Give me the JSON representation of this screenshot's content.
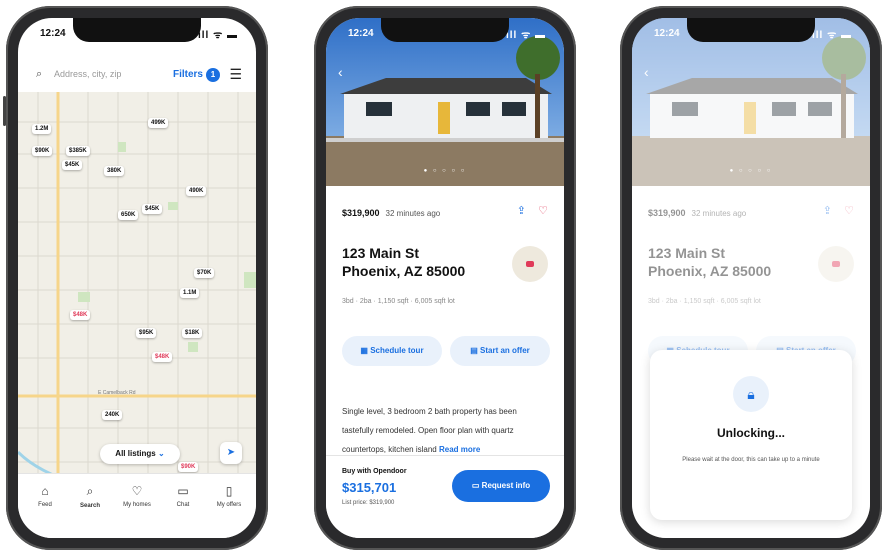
{
  "status": {
    "time": "12:24",
    "signal": "ıll ᯤ ▬"
  },
  "search": {
    "placeholder": "Address, city, zip",
    "filters_label": "Filters",
    "filters_count": "1"
  },
  "map": {
    "pins": [
      {
        "label": "1.2M"
      },
      {
        "label": "499K"
      },
      {
        "label": "$90K"
      },
      {
        "label": "$385K"
      },
      {
        "label": "$45K"
      },
      {
        "label": "380K"
      },
      {
        "label": "490K"
      },
      {
        "label": "$45K"
      },
      {
        "label": "650K"
      },
      {
        "label": "$70K"
      },
      {
        "label": "1.1M"
      },
      {
        "label": "$48K"
      },
      {
        "label": "$95K"
      },
      {
        "label": "$18K"
      },
      {
        "label": "$48K"
      },
      {
        "label": "240K"
      },
      {
        "label": "$90K"
      }
    ],
    "all_listings": "All listings",
    "street_label": "E Camelback Rd"
  },
  "tabs": [
    {
      "icon": "home-icon",
      "label": "Feed"
    },
    {
      "icon": "search-icon",
      "label": "Search"
    },
    {
      "icon": "heart-icon",
      "label": "My homes"
    },
    {
      "icon": "chat-icon",
      "label": "Chat"
    },
    {
      "icon": "document-icon",
      "label": "My offers"
    }
  ],
  "listing": {
    "price": "$319,900",
    "time_ago": "32 minutes ago",
    "address_line1": "123 Main St",
    "address_line2": "Phoenix, AZ 85000",
    "facts": "3bd · 2ba · 1,150 sqft · 6,005 sqft lot",
    "schedule_tour": "Schedule tour",
    "start_offer": "Start an offer",
    "description": "Single level, 3 bedroom 2 bath property has been tastefully remodeled. Open floor plan with quartz countertops, kitchen island",
    "read_more": "Read more",
    "buy_label": "Buy with Opendoor",
    "buy_price": "$315,701",
    "list_price": "List price: $319,900",
    "request_info": "Request info"
  },
  "unlock": {
    "title": "Unlocking...",
    "subtitle": "Please wait at the door, this can take up to a minute"
  },
  "colors": {
    "accent": "#1a6fe0",
    "heart": "#e03b5a"
  }
}
